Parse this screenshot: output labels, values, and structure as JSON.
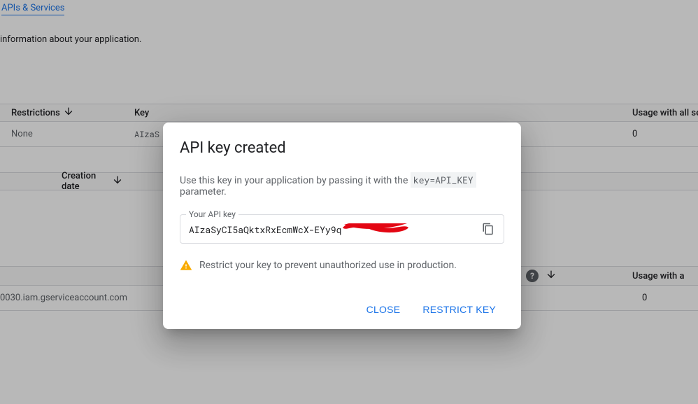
{
  "breadcrumb": {
    "label": "APIs & Services"
  },
  "info_text": "information about your application.",
  "table1": {
    "headers": {
      "restrictions": "Restrictions",
      "key": "Key",
      "usage": "Usage with all serv"
    },
    "row": {
      "restrictions": "None",
      "key_preview": "AIzaS",
      "usage": "0"
    }
  },
  "table2": {
    "headers": {
      "creation": "Creation date"
    }
  },
  "table3": {
    "headers": {
      "usage": "Usage with a"
    },
    "row": {
      "email": "0030.iam.gserviceaccount.com",
      "usage": "0"
    }
  },
  "modal": {
    "title": "API key created",
    "desc_pre": "Use this key in your application by passing it with the ",
    "desc_code": "key=API_KEY",
    "desc_post": " parameter.",
    "field_label": "Your API key",
    "field_value": "AIzaSyCI5aQktxRxEcmWcX-EYy9q",
    "warning": "Restrict your key to prevent unauthorized use in production.",
    "close": "CLOSE",
    "restrict": "RESTRICT KEY"
  }
}
